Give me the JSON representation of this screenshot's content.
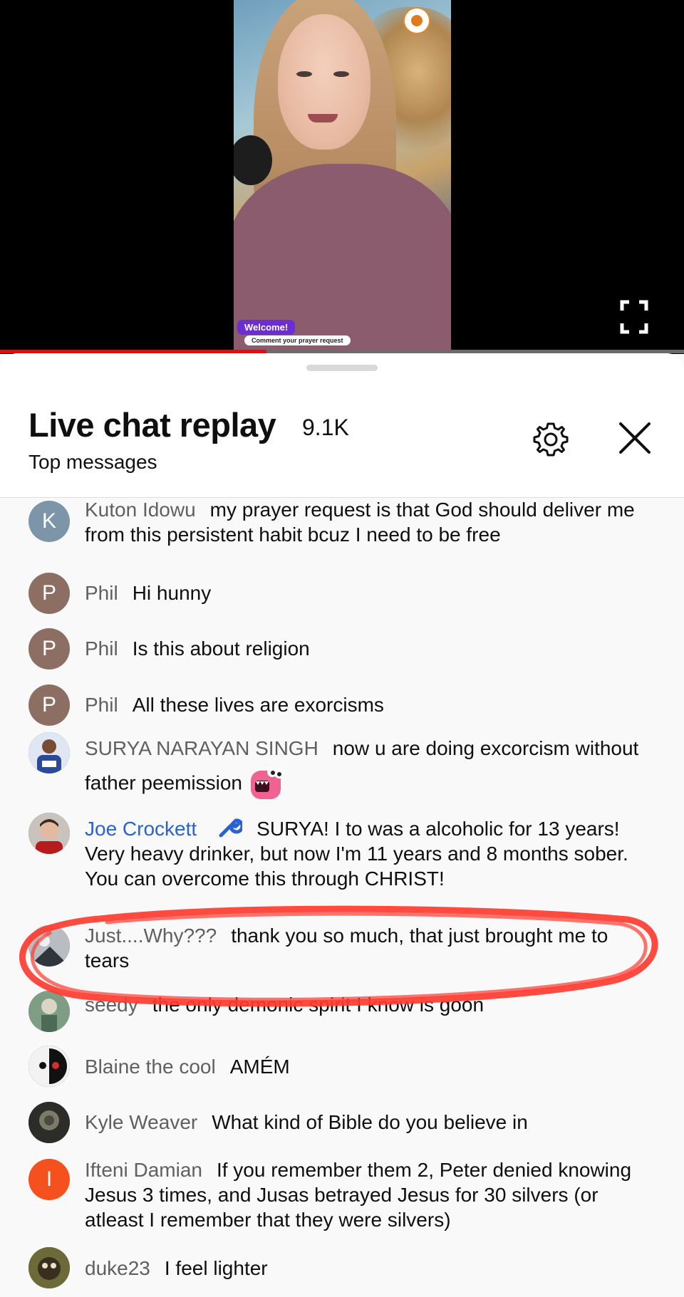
{
  "video": {
    "overlay_welcome": "Welcome!",
    "overlay_prompt": "Comment your prayer request",
    "progress_fraction": 0.39,
    "colors": {
      "progress": "#ff0000",
      "overlay_badge": "#6b2fd1"
    }
  },
  "chat_panel": {
    "title": "Live chat replay",
    "viewer_count": "9.1K",
    "filter": "Top messages",
    "settings_icon": "gear-icon",
    "close_icon": "close-icon"
  },
  "messages": [
    {
      "avatar_letter": "K",
      "avatar_color": "#7c95a8",
      "author": "Kuton Idowu",
      "text": "my prayer request is that God should deliver me from this persistent habit bcuz I need to be free"
    },
    {
      "avatar_letter": "P",
      "avatar_color": "#8d6e63",
      "author": "Phil",
      "text": "Hi hunny"
    },
    {
      "avatar_letter": "P",
      "avatar_color": "#8d6e63",
      "author": "Phil",
      "text": "Is this about religion"
    },
    {
      "avatar_letter": "P",
      "avatar_color": "#8d6e63",
      "author": "Phil",
      "text": "All these lives are exorcisms"
    },
    {
      "avatar_letter": "",
      "avatar_color": "#2c4a9a",
      "author": "SURYA NARAYAN SINGH",
      "text": "now u are doing excorcism without father peemission",
      "emoji": "pink-monster-emoji"
    },
    {
      "avatar_letter": "",
      "avatar_color": "#6b3a3a",
      "author": "Joe Crockett",
      "badge": "wrench-icon",
      "text": "SURYA! I to was a alcoholic for 13 years! Very heavy drinker, but now I'm 11 years and 8 months sober. You can overcome this through CHRIST!"
    },
    {
      "avatar_letter": "",
      "avatar_color": "#4b5560",
      "author": "Just....Why???",
      "text": "thank you so much, that just brought me to tears"
    },
    {
      "avatar_letter": "",
      "avatar_color": "#5d7a5a",
      "author": "seedy",
      "text": "the only demonic spirit I know is goon"
    },
    {
      "avatar_letter": "",
      "avatar_color": "#222222",
      "author": "Blaine the cool",
      "text": "AMÉM"
    },
    {
      "avatar_letter": "",
      "avatar_color": "#3b3b34",
      "author": "Kyle Weaver",
      "text": "What kind of Bible do you believe in"
    },
    {
      "avatar_letter": "I",
      "avatar_color": "#f4511e",
      "author": "Ifteni Damian",
      "text": "If you remember them 2, Peter denied knowing Jesus 3 times, and Jusas betrayed Jesus for 30 silvers (or atleast I remember that they were silvers)"
    },
    {
      "avatar_letter": "",
      "avatar_color": "#5a5a2e",
      "author": "duke23",
      "text": "I feel lighter"
    }
  ],
  "annotation": {
    "type": "hand-drawn ellipse",
    "color": "#ff3b30",
    "target_message": "Just....Why???"
  }
}
